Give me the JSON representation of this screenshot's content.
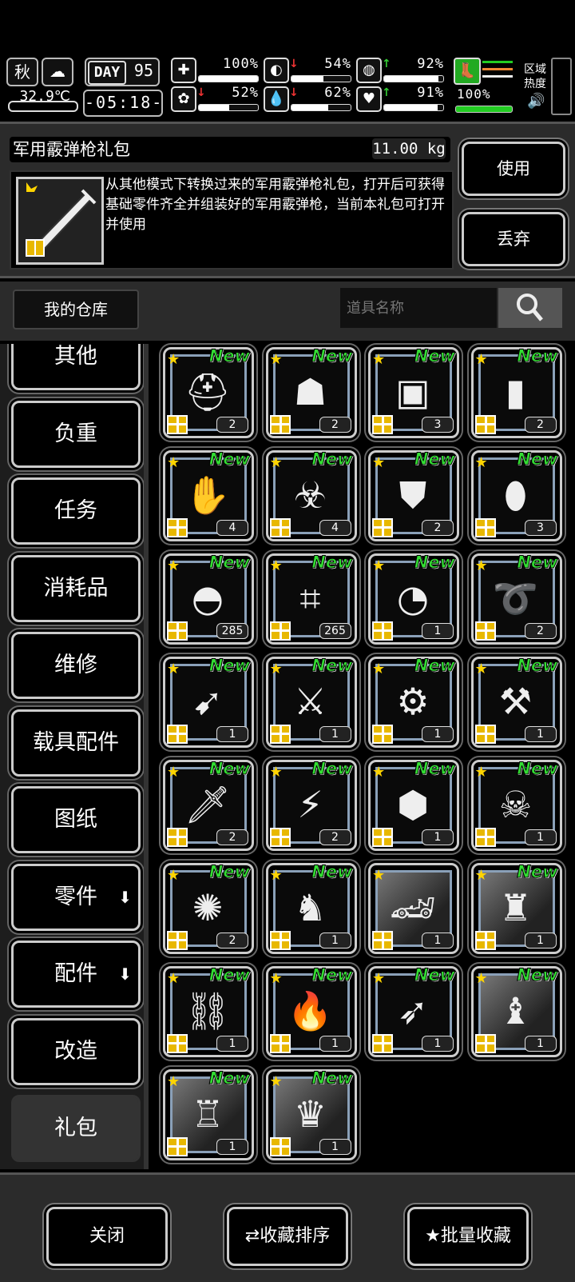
{
  "status": {
    "season": "秋",
    "weather_icon": "cloud-icon",
    "temperature": "32.9℃",
    "day_label": "DAY",
    "day_num": "95",
    "time": "-05:18-",
    "stats": [
      {
        "icon": "medkit-icon",
        "glyph": "✚",
        "arrow": "",
        "value": "100%",
        "level": 1.0
      },
      {
        "icon": "stomach-icon",
        "glyph": "◐",
        "arrow": "↓",
        "arrow_color": "red",
        "value": "54%",
        "level": 0.54
      },
      {
        "icon": "lungs-icon",
        "glyph": "◍",
        "arrow": "↑",
        "arrow_color": "green",
        "value": "92%",
        "level": 0.92
      },
      {
        "icon": "brain-icon",
        "glyph": "✿",
        "arrow": "↓",
        "arrow_color": "red",
        "value": "52%",
        "level": 0.52
      },
      {
        "icon": "water-drop-icon",
        "glyph": "💧",
        "arrow": "↓",
        "arrow_color": "red",
        "value": "62%",
        "level": 0.62
      },
      {
        "icon": "heart-icon",
        "glyph": "♥",
        "arrow": "↑",
        "arrow_color": "green",
        "value": "91%",
        "level": 0.91
      }
    ],
    "stamina": "100%",
    "zone_heat": "区域\n热度"
  },
  "detail": {
    "name": "军用霰弹枪礼包",
    "weight": "11.00 kg",
    "description": "从其他模式下转换过来的军用霰弹枪礼包，打开后可获得基础零件齐全并组装好的军用霰弹枪，当前本礼包可打开并使用",
    "use_label": "使用",
    "discard_label": "丢弃"
  },
  "warehouse": {
    "title": "我的仓库",
    "search_placeholder": "道具名称"
  },
  "categories": [
    {
      "label": "其他",
      "arrow": false,
      "active": false
    },
    {
      "label": "负重",
      "arrow": false,
      "active": false
    },
    {
      "label": "任务",
      "arrow": false,
      "active": false
    },
    {
      "label": "消耗品",
      "arrow": false,
      "active": false
    },
    {
      "label": "维修",
      "arrow": false,
      "active": false
    },
    {
      "label": "载具配件",
      "arrow": false,
      "active": false
    },
    {
      "label": "图纸",
      "arrow": false,
      "active": false
    },
    {
      "label": "零件",
      "arrow": true,
      "active": false
    },
    {
      "label": "配件",
      "arrow": true,
      "active": false
    },
    {
      "label": "改造",
      "arrow": false,
      "active": false
    },
    {
      "label": "礼包",
      "arrow": false,
      "active": true
    }
  ],
  "new_badge": "New",
  "items": [
    {
      "icon": "tactical-helmet-icon",
      "glyph": "⛑",
      "count": "2"
    },
    {
      "icon": "body-armor-icon",
      "glyph": "☗",
      "count": "2"
    },
    {
      "icon": "backpack-icon",
      "glyph": "▣",
      "count": "3"
    },
    {
      "icon": "ammo-box-icon",
      "glyph": "▮",
      "count": "2"
    },
    {
      "icon": "gauntlets-icon",
      "glyph": "✋",
      "count": "4"
    },
    {
      "icon": "gas-mask-icon",
      "glyph": "☣",
      "count": "4"
    },
    {
      "icon": "armor-vest-icon",
      "glyph": "⛊",
      "count": "2"
    },
    {
      "icon": "riot-shield-icon",
      "glyph": "⬮",
      "count": "3"
    },
    {
      "icon": "net-helmet-icon",
      "glyph": "◓",
      "count": "285"
    },
    {
      "icon": "camo-net-icon",
      "glyph": "⌗",
      "count": "265"
    },
    {
      "icon": "visor-helmet-icon",
      "glyph": "◔",
      "count": "1"
    },
    {
      "icon": "whip-icon",
      "glyph": "➰",
      "count": "2"
    },
    {
      "icon": "spear-icon",
      "glyph": "➹",
      "count": "1"
    },
    {
      "icon": "claw-weapon-icon",
      "glyph": "⚔",
      "count": "1"
    },
    {
      "icon": "mounted-gun-icon",
      "glyph": "⚙",
      "count": "1"
    },
    {
      "icon": "crossbow-icon",
      "glyph": "⚒",
      "count": "1"
    },
    {
      "icon": "sword-icon",
      "glyph": "🗡",
      "count": "2"
    },
    {
      "icon": "serrated-blade-icon",
      "glyph": "⚡",
      "count": "2"
    },
    {
      "icon": "hex-shield-icon",
      "glyph": "⬢",
      "count": "1"
    },
    {
      "icon": "gold-mask-icon",
      "glyph": "☠",
      "count": "1"
    },
    {
      "icon": "scorpion-blade-icon",
      "glyph": "✺",
      "count": "2"
    },
    {
      "icon": "dragon-emblem-icon",
      "glyph": "♞",
      "count": "1"
    },
    {
      "icon": "sports-car-icon",
      "glyph": "🏎",
      "count": "1",
      "photo": true,
      "new": false
    },
    {
      "icon": "armored-suit-icon",
      "glyph": "♜",
      "count": "1",
      "photo": true
    },
    {
      "icon": "chainsaw-icon",
      "glyph": "⛓",
      "count": "1"
    },
    {
      "icon": "flame-armor-icon",
      "glyph": "🔥",
      "count": "1"
    },
    {
      "icon": "assault-rifle-icon",
      "glyph": "➶",
      "count": "1"
    },
    {
      "icon": "armored-figure-icon",
      "glyph": "♝",
      "count": "1",
      "photo": true
    },
    {
      "icon": "knight-armor-icon",
      "glyph": "♖",
      "count": "1",
      "photo": true
    },
    {
      "icon": "mech-warrior-icon",
      "glyph": "♛",
      "count": "1",
      "photo": true
    }
  ],
  "bottom": {
    "close_label": "关闭",
    "sort_label": "收藏排序",
    "batch_label": "批量收藏"
  },
  "colors": {
    "new_green": "#33dd33",
    "panel": "#2b2b2b",
    "gift_gold": "#e8b800"
  }
}
